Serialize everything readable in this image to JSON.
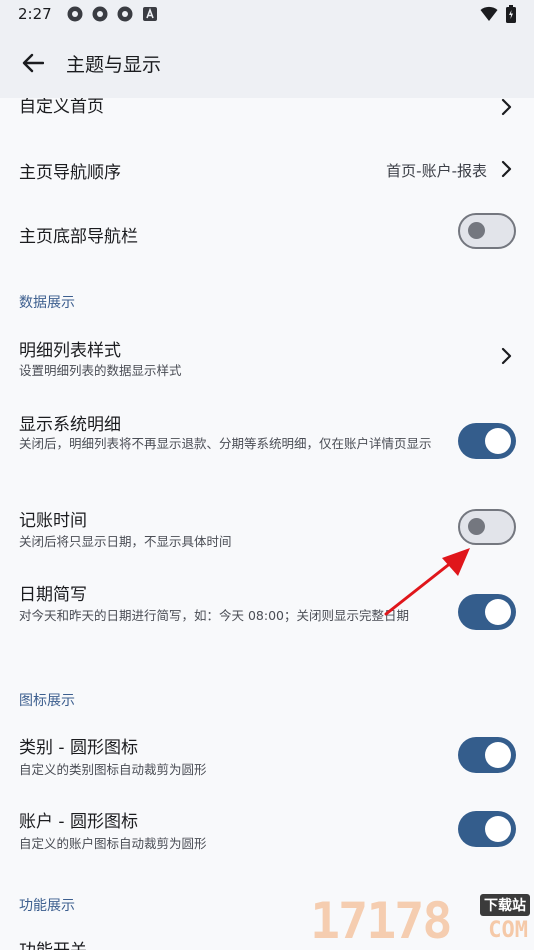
{
  "status": {
    "time": "2:27"
  },
  "header": {
    "title": "主题与显示"
  },
  "rows": {
    "custom_home": {
      "title": "自定义首页"
    },
    "nav_order": {
      "title": "主页导航顺序",
      "value": "首页-账户-报表"
    },
    "bottom_nav": {
      "title": "主页底部导航栏",
      "on": false
    }
  },
  "sections": {
    "data": "数据展示",
    "icon": "图标展示",
    "feature": "功能展示"
  },
  "data_rows": {
    "list_style": {
      "title": "明细列表样式",
      "sub": "设置明细列表的数据显示样式"
    },
    "system_detail": {
      "title": "显示系统明细",
      "sub": "关闭后，明细列表将不再显示退款、分期等系统明细，仅在账户详情页显示",
      "on": true
    },
    "record_time": {
      "title": "记账时间",
      "sub": "关闭后将只显示日期，不显示具体时间",
      "on": false
    },
    "date_short": {
      "title": "日期简写",
      "sub": "对今天和昨天的日期进行简写，如：今天 08:00；关闭则显示完整日期",
      "on": true
    }
  },
  "icon_rows": {
    "category_round": {
      "title": "类别 - 圆形图标",
      "sub": "自定义的类别图标自动裁剪为圆形",
      "on": true
    },
    "account_round": {
      "title": "账户 - 圆形图标",
      "sub": "自定义的账户图标自动裁剪为圆形",
      "on": true
    }
  },
  "feature_rows": {
    "feature_switch": {
      "title": "功能开关"
    }
  },
  "watermark": {
    "text": "17178",
    "badge": "下载站",
    "domain": "COM"
  },
  "colors": {
    "switch_on": "#345d8c",
    "switch_off_border": "#74777f",
    "section": "#3d5f8f",
    "annotation_arrow": "#e0161b"
  }
}
